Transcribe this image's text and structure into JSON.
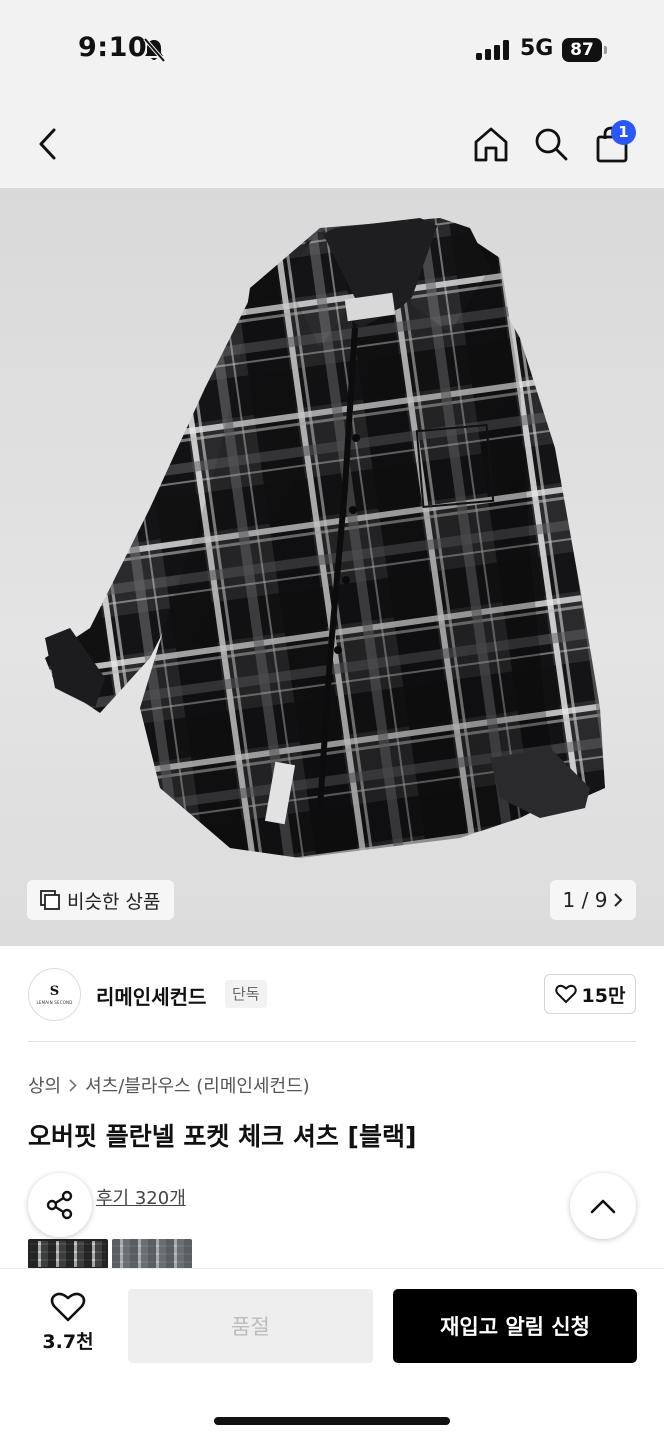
{
  "status_bar": {
    "time": "9:10",
    "network": "5G",
    "battery": "87"
  },
  "nav": {
    "back_icon": "chevron-left-icon",
    "home_icon": "home-icon",
    "search_icon": "search-icon",
    "cart_icon": "shopping-bag-icon",
    "cart_count": "1"
  },
  "gallery": {
    "similar_label": "비슷한 상품",
    "page_indicator": "1 / 9"
  },
  "brand": {
    "logo_monogram": "S",
    "logo_caption": "LEMAIN SECOND",
    "name": "리메인세컨드",
    "tag": "단독",
    "likes": "15만"
  },
  "product": {
    "breadcrumb": [
      "상의",
      "셔츠/블라우스 (리메인세컨드)"
    ],
    "title": "오버핏 플란넬 포켓 체크 셔츠 [블랙]",
    "review_link": "후기 320개"
  },
  "bottom_bar": {
    "wish_count": "3.7천",
    "soldout_label": "품절",
    "restock_label": "재입고 알림 신청"
  },
  "colors": {
    "accent_badge": "#2a58ff",
    "primary_button": "#000000",
    "disabled_button": "#eeeeee"
  }
}
